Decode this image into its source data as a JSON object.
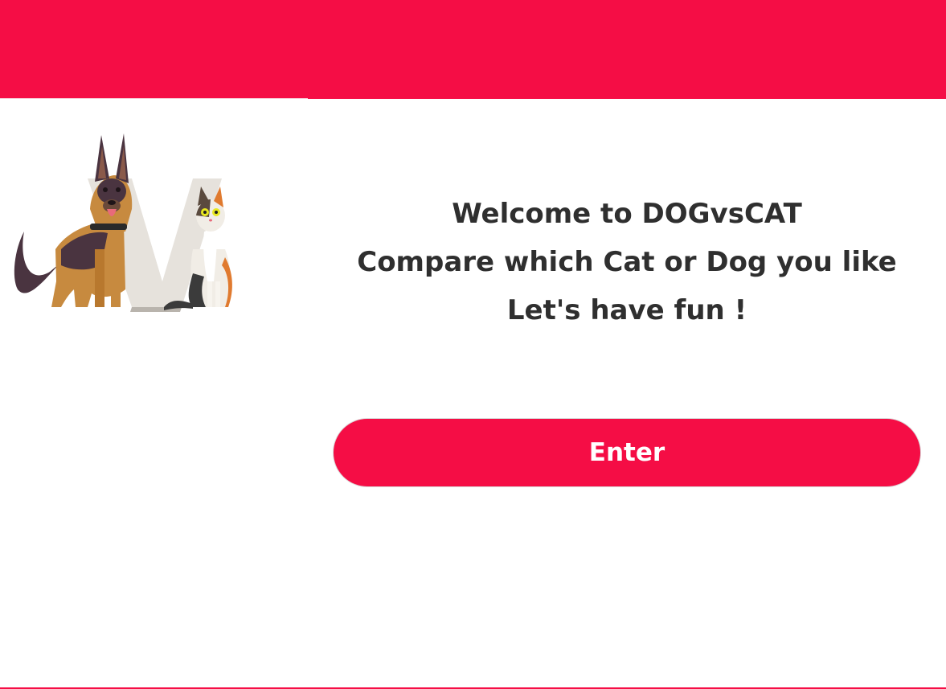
{
  "header": {
    "color": "#f50d45"
  },
  "logo": {
    "icon": "dog-vs-cat-logo-icon"
  },
  "welcome": {
    "line1": "Welcome to DOGvsCAT",
    "line2": "Compare which Cat or Dog you like",
    "line3": "Let's have fun !"
  },
  "enter_button": {
    "label": "Enter",
    "color": "#f50d45"
  }
}
